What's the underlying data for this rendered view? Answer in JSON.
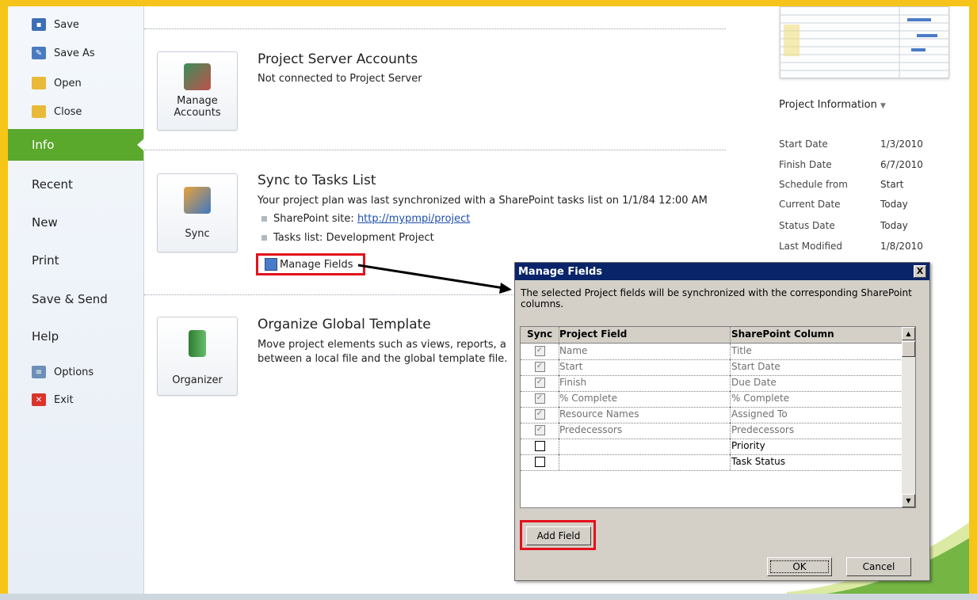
{
  "nav": {
    "commands": [
      {
        "label": "Save",
        "icon": "save-icon"
      },
      {
        "label": "Save As",
        "icon": "save-as-icon"
      },
      {
        "label": "Open",
        "icon": "open-folder-icon"
      },
      {
        "label": "Close",
        "icon": "close-folder-icon"
      }
    ],
    "tabs": [
      {
        "label": "Info",
        "active": true
      },
      {
        "label": "Recent"
      },
      {
        "label": "New"
      },
      {
        "label": "Print"
      },
      {
        "label": "Save & Send"
      },
      {
        "label": "Help"
      }
    ],
    "bottom": [
      {
        "label": "Options",
        "icon": "options-icon"
      },
      {
        "label": "Exit",
        "icon": "exit-icon"
      }
    ]
  },
  "sections": {
    "accounts": {
      "button_label_1": "Manage",
      "button_label_2": "Accounts",
      "title": "Project Server Accounts",
      "text": "Not connected to Project Server"
    },
    "sync": {
      "button_label": "Sync",
      "title": "Sync to Tasks List",
      "text": "Your project plan was last synchronized with a SharePoint tasks list on 1/1/84 12:00 AM",
      "site_label": "SharePoint site:",
      "site_url": "http://mypmpi/project",
      "list_label": "Tasks list:",
      "list_value": "Development Project",
      "manage_fields": "Manage Fields"
    },
    "organizer": {
      "button_label": "Organizer",
      "title": "Organize Global Template",
      "text_1": "Move project elements such as views, reports, a",
      "text_2": "between a local file and the global template file."
    }
  },
  "project_info": {
    "title": "Project Information",
    "rows": [
      {
        "label": "Start Date",
        "value": "1/3/2010"
      },
      {
        "label": "Finish Date",
        "value": "6/7/2010"
      },
      {
        "label": "Schedule from",
        "value": "Start"
      },
      {
        "label": "Current Date",
        "value": "Today"
      },
      {
        "label": "Status Date",
        "value": "Today"
      },
      {
        "label": "Last Modified",
        "value": "1/8/2010"
      }
    ]
  },
  "dialog": {
    "title": "Manage Fields",
    "close": "X",
    "description": "The selected Project fields will be synchronized with the corresponding SharePoint columns.",
    "columns": [
      "Sync",
      "Project Field",
      "SharePoint Column"
    ],
    "rows": [
      {
        "checked": true,
        "enabled": false,
        "project_field": "Name",
        "sharepoint_column": "Title"
      },
      {
        "checked": true,
        "enabled": false,
        "project_field": "Start",
        "sharepoint_column": "Start Date"
      },
      {
        "checked": true,
        "enabled": false,
        "project_field": "Finish",
        "sharepoint_column": "Due Date"
      },
      {
        "checked": true,
        "enabled": false,
        "project_field": "% Complete",
        "sharepoint_column": "% Complete"
      },
      {
        "checked": true,
        "enabled": false,
        "project_field": "Resource Names",
        "sharepoint_column": "Assigned To"
      },
      {
        "checked": true,
        "enabled": false,
        "project_field": "Predecessors",
        "sharepoint_column": "Predecessors"
      },
      {
        "checked": false,
        "enabled": true,
        "project_field": "",
        "sharepoint_column": "Priority"
      },
      {
        "checked": false,
        "enabled": true,
        "project_field": "",
        "sharepoint_column": "Task Status"
      }
    ],
    "add_field": "Add Field",
    "ok": "OK",
    "cancel": "Cancel"
  },
  "colors": {
    "accent_green": "#5aa82c",
    "highlight_red": "#e3111c",
    "frame_yellow": "#f5c518",
    "dialog_title": "#0a246a"
  }
}
